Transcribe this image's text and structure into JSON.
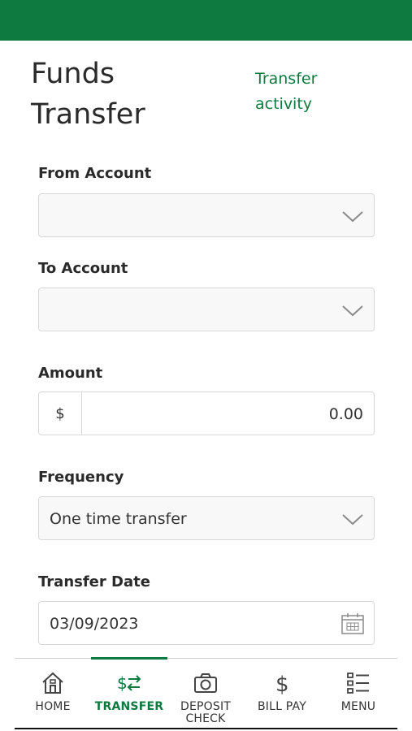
{
  "page": {
    "title": "Funds Transfer",
    "activity_link": "Transfer activity"
  },
  "form": {
    "from_account": {
      "label": "From Account",
      "value": ""
    },
    "to_account": {
      "label": "To Account",
      "value": ""
    },
    "amount": {
      "label": "Amount",
      "currency_symbol": "$",
      "value": "0.00"
    },
    "frequency": {
      "label": "Frequency",
      "value": "One time transfer"
    },
    "transfer_date": {
      "label": "Transfer Date",
      "value": "03/09/2023"
    }
  },
  "tabs": [
    {
      "label": "HOME",
      "icon": "home-icon",
      "active": false
    },
    {
      "label": "TRANSFER",
      "icon": "transfer-icon",
      "active": true
    },
    {
      "label": "DEPOSIT CHECK",
      "icon": "camera-icon",
      "active": false
    },
    {
      "label": "BILL PAY",
      "icon": "dollar-icon",
      "active": false
    },
    {
      "label": "MENU",
      "icon": "menu-icon",
      "active": false
    }
  ],
  "colors": {
    "brand": "#0e7a3f",
    "field_background": "#f8f8f8",
    "field_border": "#d8d8d8"
  }
}
